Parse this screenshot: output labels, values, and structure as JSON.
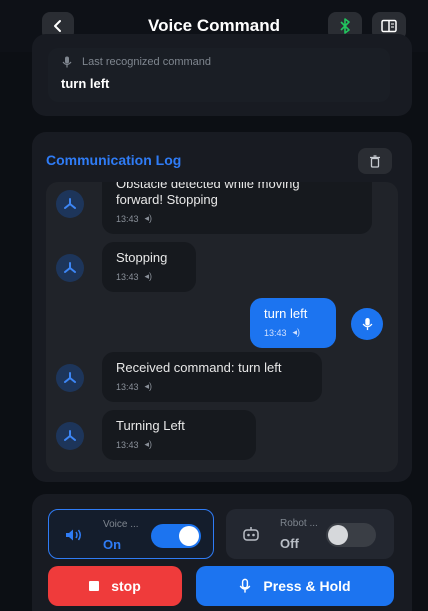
{
  "header": {
    "title": "Voice Command",
    "back_icon": "chevron-left-icon",
    "bluetooth_icon": "bluetooth-icon",
    "book_icon": "book-icon"
  },
  "recognized": {
    "label": "Last recognized command",
    "value": "turn left"
  },
  "log": {
    "title": "Communication Log",
    "messages": [
      {
        "from": "robot",
        "text_line1": "Obstacle detected while moving",
        "text_line2": "forward! Stopping",
        "time": "13:43"
      },
      {
        "from": "robot",
        "text": "Stopping",
        "time": "13:43"
      },
      {
        "from": "user",
        "text": "turn left",
        "time": "13:43"
      },
      {
        "from": "robot",
        "text": "Received command: turn left",
        "time": "13:43"
      },
      {
        "from": "robot",
        "text": "Turning Left",
        "time": "13:43"
      }
    ]
  },
  "controls": {
    "voice": {
      "label": "Voice ...",
      "state": "On",
      "enabled": true
    },
    "robot": {
      "label": "Robot ...",
      "state": "Off",
      "enabled": false
    },
    "stop_label": "stop",
    "press_label": "Press & Hold"
  },
  "colors": {
    "accent": "#1c74f0",
    "title_blue": "#2f7cf6",
    "stop_red": "#ef3b3b",
    "bluetooth_green": "#22c55e"
  }
}
